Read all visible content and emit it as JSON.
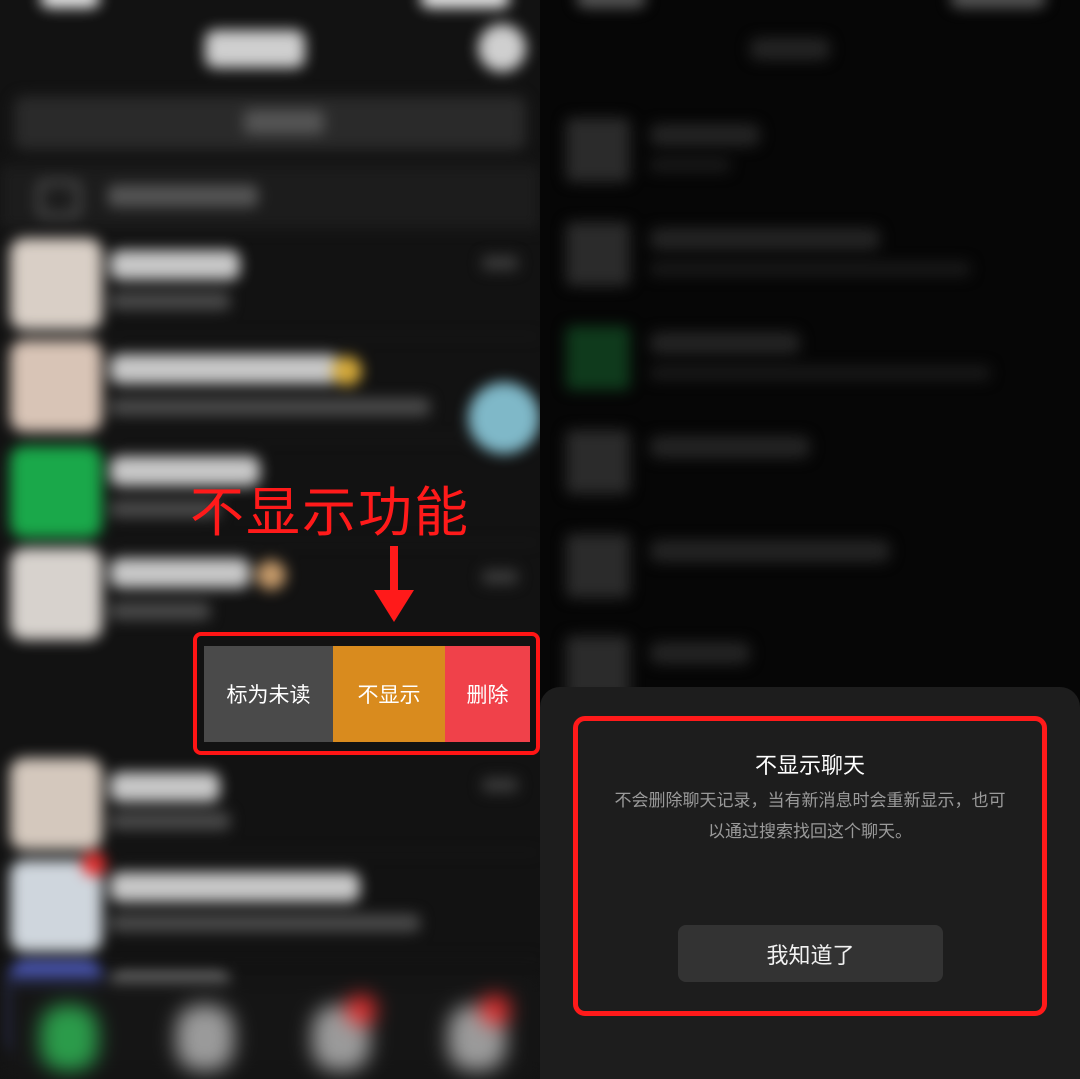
{
  "annotation": {
    "label": "不显示功能",
    "color": "#ff1a1a"
  },
  "swipe_actions": {
    "mark_unread": "标为未读",
    "hide": "不显示",
    "delete": "删除"
  },
  "hide_chat_dialog": {
    "title": "不显示聊天",
    "description": "不会删除聊天记录，当有新消息时会重新显示，也可以通过搜索找回这个聊天。",
    "confirm_button": "我知道了"
  },
  "colors": {
    "hide_action": "#d98b1e",
    "delete_action": "#f0414a",
    "mark_unread_action": "#4a4a4a",
    "highlight_frame": "#ff1a1a"
  },
  "icons": [
    "add-icon",
    "search-icon",
    "desktop-icon",
    "down-arrow-icon"
  ]
}
